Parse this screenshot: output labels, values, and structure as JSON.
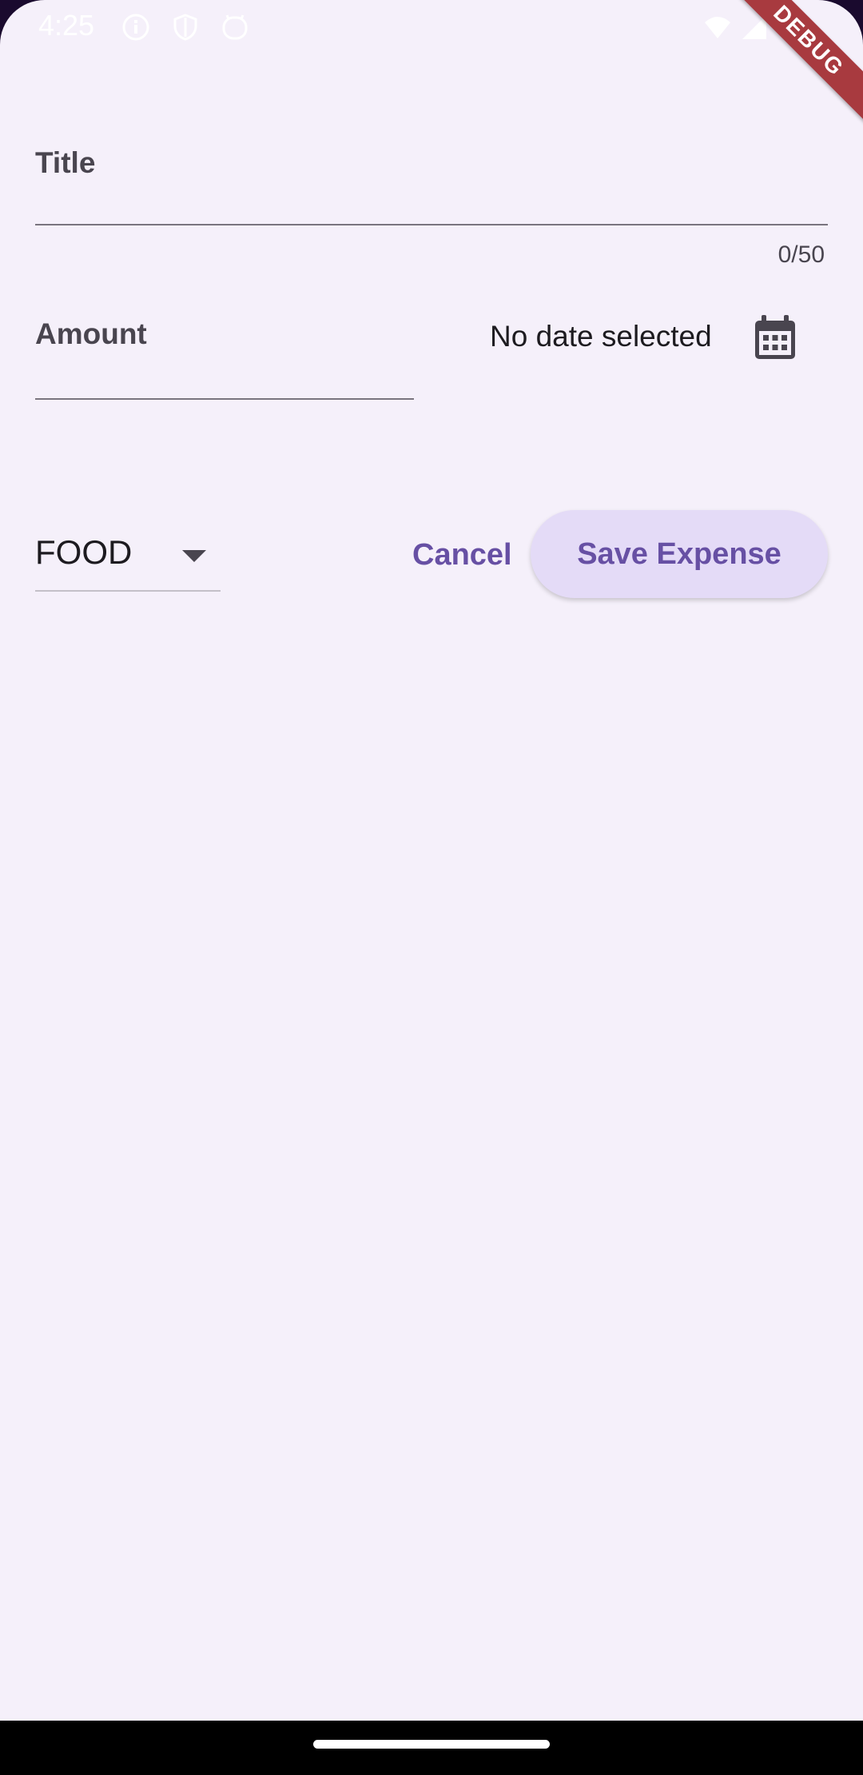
{
  "status_bar": {
    "time": "4:25",
    "icons": [
      "info-icon",
      "shield-icon",
      "face-icon",
      "wifi-icon",
      "signal-icon",
      "battery-icon"
    ]
  },
  "debug_ribbon": "DEBUG",
  "form": {
    "title_label": "Title",
    "title_counter": "0/50",
    "amount_label": "Amount",
    "date_text": "No date selected",
    "category_value": "FOOD",
    "cancel_label": "Cancel",
    "save_label": "Save Expense"
  },
  "colors": {
    "background": "#f5f0fa",
    "accent": "#6750a4",
    "save_button_bg": "#e4dbf7",
    "debug_ribbon": "#a83a3f"
  }
}
